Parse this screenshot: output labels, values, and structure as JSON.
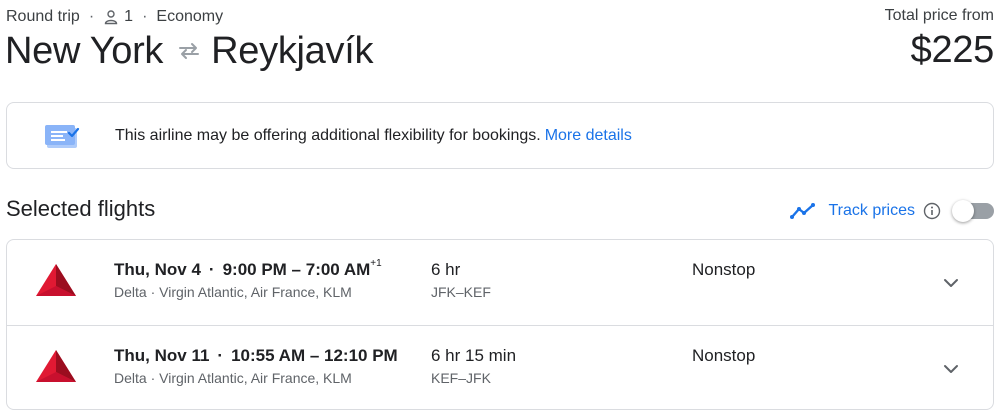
{
  "header": {
    "trip_type": "Round trip",
    "passengers": "1",
    "cabin": "Economy",
    "origin": "New York",
    "destination": "Reykjavík",
    "price_label": "Total price from",
    "price": "$225"
  },
  "notice": {
    "text": "This airline may be offering additional flexibility for bookings.",
    "link": "More details"
  },
  "section": {
    "title": "Selected flights",
    "track_label": "Track prices",
    "track_enabled": false
  },
  "flights": [
    {
      "date": "Thu, Nov 4",
      "depart": "9:00 PM",
      "arrive": "7:00 AM",
      "day_offset": "+1",
      "airlines": "Delta · Virgin Atlantic, Air France, KLM",
      "duration": "6 hr",
      "airports": "JFK–KEF",
      "stops": "Nonstop"
    },
    {
      "date": "Thu, Nov 11",
      "depart": "10:55 AM",
      "arrive": "12:10 PM",
      "day_offset": "",
      "airlines": "Delta · Virgin Atlantic, Air France, KLM",
      "duration": "6 hr 15 min",
      "airports": "KEF–JFK",
      "stops": "Nonstop"
    }
  ],
  "colors": {
    "accent": "#1a73e8",
    "delta_red": "#c8102e",
    "border": "#dadce0",
    "toggle_off": "#9aa0a6"
  }
}
